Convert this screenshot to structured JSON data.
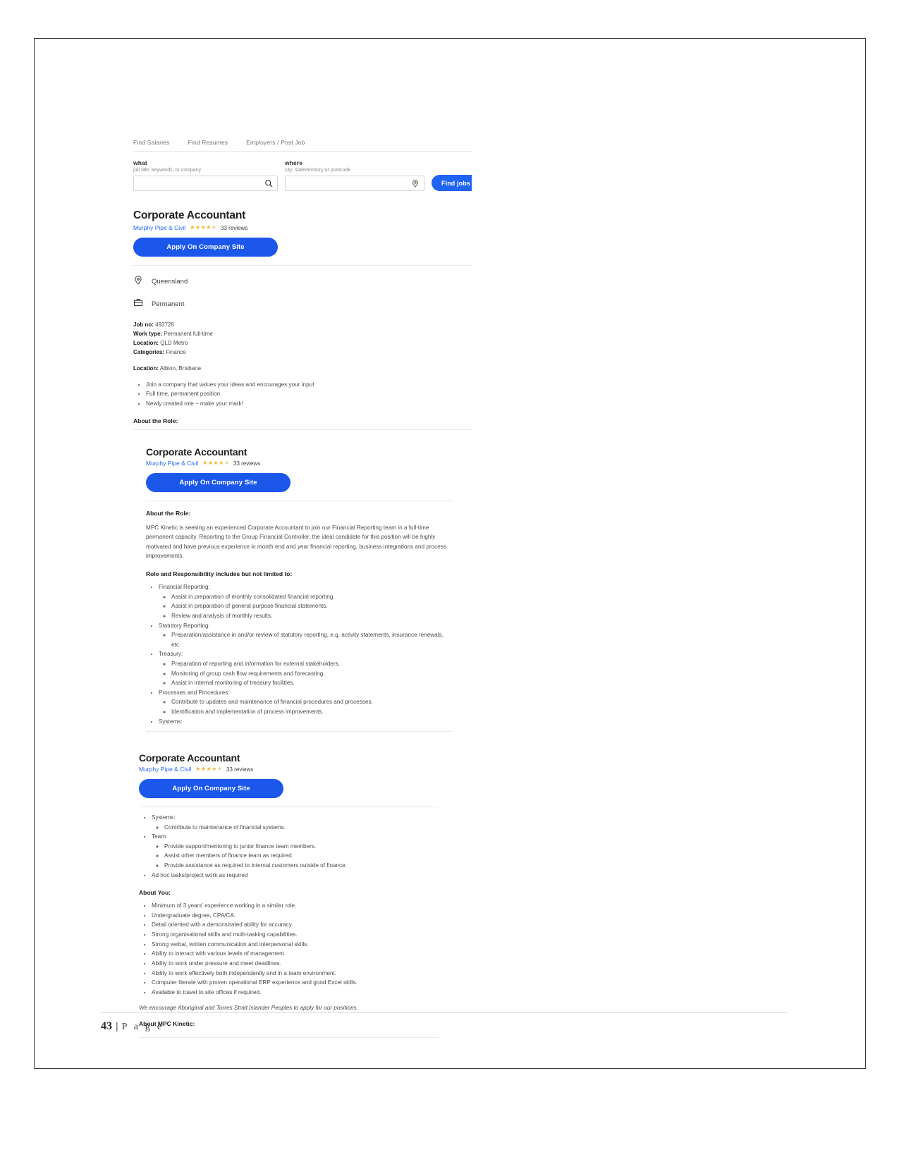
{
  "nav": {
    "items": [
      "Find Salaries",
      "Find Resumes",
      "Employers / Post Job"
    ]
  },
  "search": {
    "what_label": "what",
    "what_hint": "job title, keywords, or company",
    "what_value": "",
    "where_label": "where",
    "where_hint": "city, state/territory or postcode",
    "where_value": "",
    "find_button": "Find jobs",
    "search_icon": "search-icon",
    "location_icon": "map-pin-icon"
  },
  "job": {
    "title": "Corporate Accountant",
    "company": "Murphy Pipe & Civil",
    "rating": 4,
    "rating_max": 5,
    "reviews": "33 reviews",
    "apply_label": "Apply On Company Site",
    "location_chip": "Queensland",
    "type_chip": "Permanent",
    "location_icon": "map-pin-icon",
    "briefcase_icon": "briefcase-icon",
    "details": [
      {
        "label": "Job no:",
        "value": "493728"
      },
      {
        "label": "Work type:",
        "value": "Permanent full-time"
      },
      {
        "label": "Location:",
        "value": "QLD Metro"
      },
      {
        "label": "Categories:",
        "value": "Finance"
      }
    ],
    "location_label": "Location:",
    "location_value": "Albion, Brisbane",
    "highlights": [
      "Join a company that values your ideas and encourages your input",
      "Full time, permanent position",
      "Newly created role – make your mark!"
    ],
    "cut_heading": "About the Role:"
  },
  "panel2": {
    "about_role_heading": "About the Role:",
    "about_role_body": "MPC Kinetic is seeking an experienced Corporate Accountant to join our Financial Reporting team in a full-time permanent capacity. Reporting to the Group Financial Controller, the ideal candidate for this position will be highly motivated and have previous experience in month end and year financial reporting, business integrations and process improvements.",
    "responsibility_heading": "Role and Responsibility includes but not limited to:",
    "groups": [
      {
        "label": "Financial Reporting:",
        "items": [
          "Assist in preparation of monthly consolidated financial reporting.",
          "Assist in preparation of general purpose financial statements.",
          "Review and analysis of monthly results."
        ]
      },
      {
        "label": "Statutory Reporting:",
        "items": [
          "Preparation/assistance in and/or review of statutory reporting, e.g. activity statements, insurance renewals, etc."
        ]
      },
      {
        "label": "Treasury:",
        "items": [
          "Preparation of reporting and information for external stakeholders.",
          "Monitoring of group cash flow requirements and forecasting.",
          "Assist in internal monitoring of treasury facilities."
        ]
      },
      {
        "label": "Processes and Procedures:",
        "items": [
          "Contribute to updates and maintenance of financial procedures and processes.",
          "Identification and implementation of process improvements."
        ]
      },
      {
        "label": "Systems:",
        "items": []
      }
    ]
  },
  "panel3": {
    "groups": [
      {
        "label": "Systems:",
        "items": [
          "Contribute to maintenance of financial systems."
        ]
      },
      {
        "label": "Team:",
        "items": [
          "Provide support/mentoring to junior finance team members.",
          "Assist other members of finance team as required.",
          "Provide assistance as required to internal customers outside of finance."
        ]
      }
    ],
    "adhoc": "Ad hoc tasks/project work as required",
    "about_you_heading": "About You:",
    "about_you": [
      "Minimum of 3 years’ experience working in a similar role.",
      "Undergraduate degree, CPA/CA.",
      "Detail oriented with a demonstrated ability for accuracy.",
      "Strong organisational skills and multi-tasking capabilities.",
      "Strong verbal, written communication and interpersonal skills.",
      "Ability to interact with various levels of management.",
      "Ability to work under pressure and meet deadlines.",
      "Ability to work effectively both independently and in a team environment.",
      "Computer literate with proven operational ERP experience and good Excel skills.",
      "Available to travel to site offices if required."
    ],
    "encourage_note": "We encourage Aboriginal and Torres Strait Islander Peoples to apply for our positions.",
    "about_company_heading": "About MPC Kinetic:"
  },
  "footer": {
    "page_number": "43",
    "separator": "|",
    "page_word": "P a g e"
  },
  "colors": {
    "accent_blue": "#1b57eb",
    "link_blue": "#2164f3",
    "star_gold": "#f0b429"
  }
}
